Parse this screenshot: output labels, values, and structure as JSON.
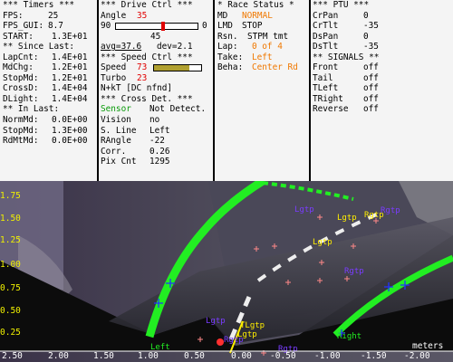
{
  "timers": {
    "header": "*** Timers ***",
    "fps_label": "FPS:",
    "fps": "25",
    "fps_gui_label": "FPS_GUI:",
    "fps_gui": "8.7",
    "start_label": "START:",
    "start": "1.3E+01",
    "since_header": "** Since Last:",
    "lapcnt_label": "LapCnt:",
    "lapcnt": "1.4E+01",
    "mdchg_label": "MdChg:",
    "mdchg": "1.2E+01",
    "stopmd_label": "StopMd:",
    "stopmd": "1.2E+01",
    "crossd_label": "CrossD:",
    "crossd": "1.4E+04",
    "dlight_label": "DLight:",
    "dlight": "1.4E+04",
    "inlast_header": "** In Last:",
    "normmd_label": "NormMd:",
    "normmd": "0.0E+00",
    "stopmd2_label": "StopMd:",
    "stopmd2": "1.3E+00",
    "rdmtmd_label": "RdMtMd:",
    "rdmtmd": "0.0E+00"
  },
  "drive": {
    "header": "***  Drive Ctrl  ***",
    "angle_label": "Angle",
    "angle": "35",
    "slider_min": "90",
    "slider_max": "0",
    "slider_value": "45",
    "avg": "avg=37.6",
    "dev": "dev=2.1",
    "speed_header": "***  Speed Ctrl  ***",
    "speed_label": "Speed",
    "speed": "73",
    "speed_fill": 0.75,
    "turbo_label": "Turbo",
    "turbo": "23",
    "nkt": "N+kT [DC nfnd]",
    "cross_header": "*** Cross Det. ***",
    "sensor_label": "Sensor",
    "sensor": "Not Detect.",
    "vision_label": "Vision",
    "vision": "no",
    "sline_label": "S. Line",
    "sline": "Left",
    "rangle_label": "RAngle",
    "rangle": "-22",
    "corr_label": "Corr.",
    "corr": "0.26",
    "pix_label": "Pix Cnt",
    "pix": "1295"
  },
  "race": {
    "header": "* Race Status *",
    "md_label": "MD",
    "md": "NORMAL",
    "lmd_label": "LMD",
    "lmd": "STOP",
    "rsn_label": "Rsn.",
    "rsn": "STPM tmt",
    "lap_label": "Lap:",
    "lap": "0 of 4",
    "take_label": "Take:",
    "take": "Left",
    "beha_label": "Beha:",
    "beha": "Center Rd"
  },
  "ptu": {
    "header": "*** PTU ***",
    "crpan_label": "CrPan",
    "crpan": "0",
    "crtlt_label": "CrTlt",
    "crtlt": "-35",
    "dspan_label": "DsPan",
    "dspan": "0",
    "dstlt_label": "DsTlt",
    "dstlt": "-35",
    "signals_header": "** SIGNALS **",
    "front_label": "Front",
    "front": "off",
    "tail_label": "Tail",
    "tail": "off",
    "tleft_label": "TLeft",
    "tleft": "off",
    "tright_label": "TRight",
    "tright": "off",
    "reverse_label": "Reverse",
    "reverse": "off"
  },
  "camera": {
    "y_ticks": [
      "1.75",
      "1.50",
      "1.25",
      "1.00",
      "0.75",
      "0.50",
      "0.25"
    ],
    "x_ticks": [
      "2.50",
      "2.00",
      "1.50",
      "1.00",
      "0.50",
      "0.00",
      "-0.50",
      "-1.00",
      "-1.50",
      "-2.00"
    ],
    "x_unit": "meters",
    "labels": {
      "left": "Left",
      "right": "Right",
      "lgtp_top": "Lgtp",
      "rgtp_top": "Rgtp",
      "lgtp_mid": "Lgtp",
      "rgtp_right": "Rgtp",
      "lgtp_bottom": "Lgtp",
      "rgtp_bottom": "Rgtp",
      "tlgtp": "TLgtp",
      "lgtp_low": "Lgtp",
      "lgtp_mid2": "Lgtp",
      "rgtp_low": "Rgtp",
      "rgtp_tr": "Rgtp"
    },
    "colors": {
      "lane": "#22ee22",
      "marker_blue": "#2233ff",
      "marker_purple": "#7a3cff",
      "marker_yellow": "#ffee00",
      "marker_red": "#ff4040",
      "cross": "#ff8888"
    }
  }
}
